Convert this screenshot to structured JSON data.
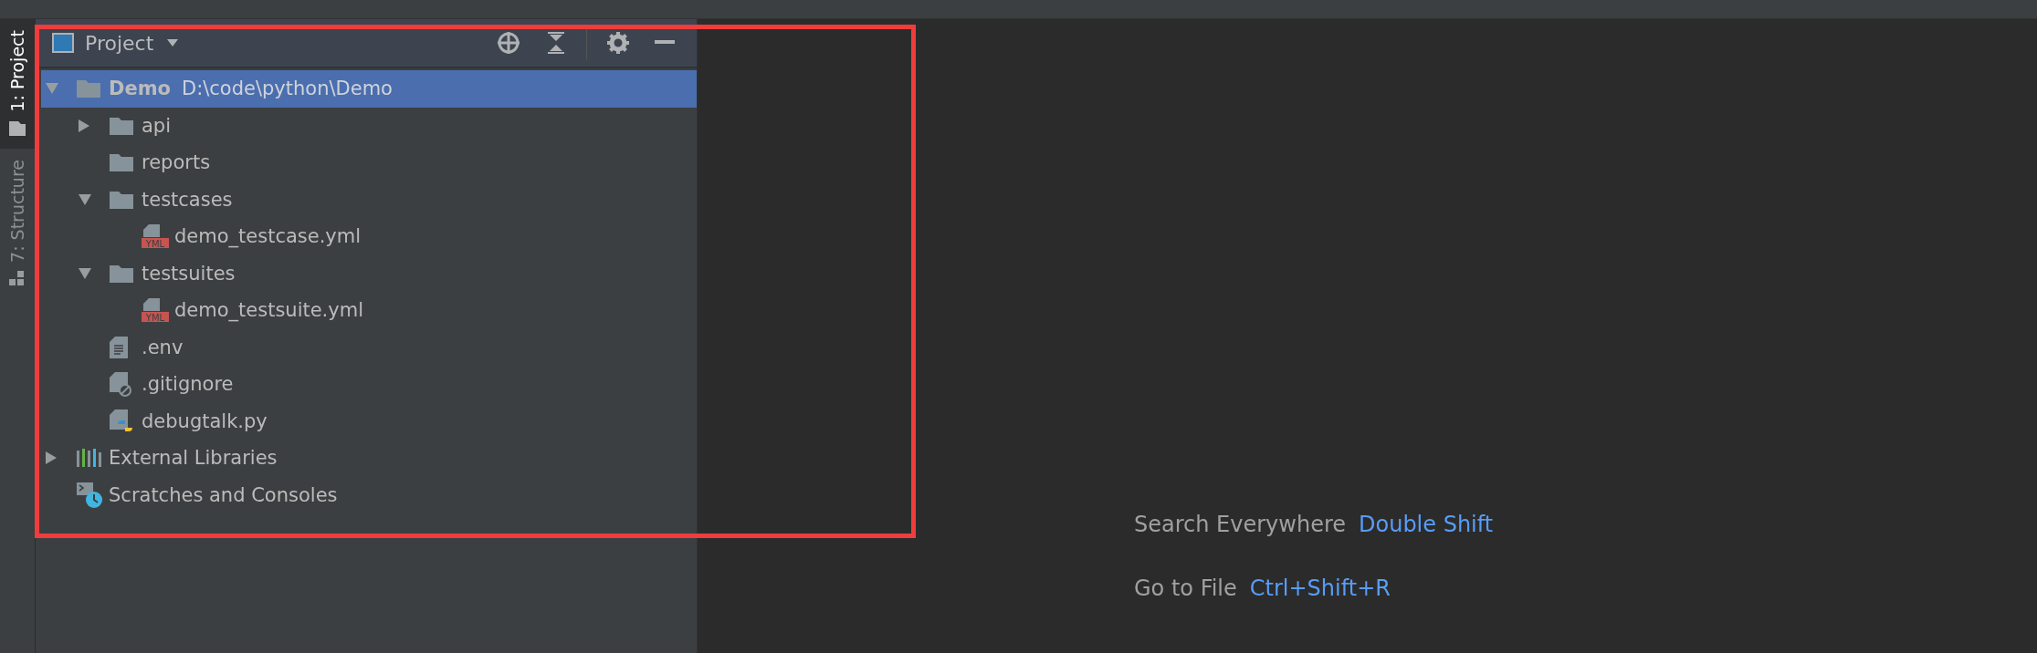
{
  "tool_stripe": [
    {
      "label": "1: Project",
      "kind": "folder",
      "selected": true
    },
    {
      "label": "7: Structure",
      "kind": "structure",
      "selected": false
    }
  ],
  "project_panel": {
    "title": "Project",
    "tree": [
      {
        "label": "Demo",
        "path": "D:\\code\\python\\Demo",
        "kind": "folder",
        "expanded": true,
        "selected": true,
        "children": [
          {
            "label": "api",
            "kind": "folder",
            "expanded": false,
            "selected": false
          },
          {
            "label": "reports",
            "kind": "folder",
            "selected": false
          },
          {
            "label": "testcases",
            "kind": "folder",
            "expanded": true,
            "selected": false,
            "children": [
              {
                "label": "demo_testcase.yml",
                "kind": "yml",
                "badge": "YML",
                "selected": false
              }
            ]
          },
          {
            "label": "testsuites",
            "kind": "folder",
            "expanded": true,
            "selected": false,
            "children": [
              {
                "label": "demo_testsuite.yml",
                "kind": "yml",
                "badge": "YML",
                "selected": false
              }
            ]
          },
          {
            "label": ".env",
            "kind": "text",
            "selected": false
          },
          {
            "label": ".gitignore",
            "kind": "ignored",
            "selected": false
          },
          {
            "label": "debugtalk.py",
            "kind": "python",
            "selected": false
          }
        ]
      },
      {
        "label": "External Libraries",
        "kind": "libraries",
        "expanded": false,
        "selected": false
      },
      {
        "label": "Scratches and Consoles",
        "kind": "scratches",
        "selected": false
      }
    ]
  },
  "editor_hints": [
    {
      "action": "Search Everywhere",
      "shortcut": "Double Shift"
    },
    {
      "action": "Go to File",
      "shortcut": "Ctrl+Shift+R"
    }
  ]
}
